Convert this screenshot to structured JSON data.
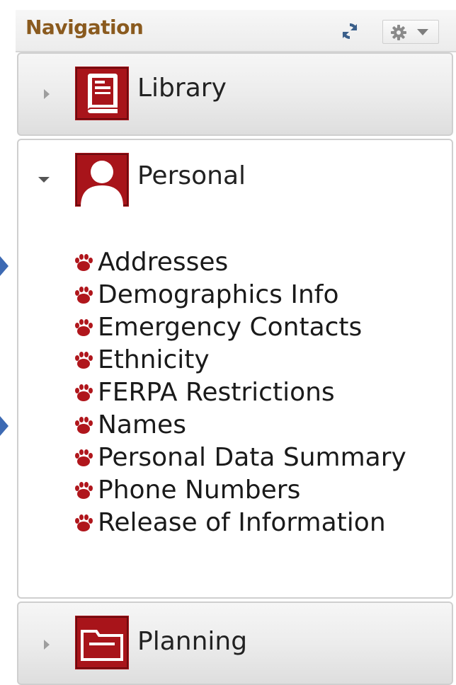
{
  "navigation": {
    "title": "Navigation",
    "refresh_icon": "refresh-icon",
    "settings_icon": "gear-icon"
  },
  "sections": [
    {
      "label": "Library",
      "state": "collapsed",
      "icon": "book-icon"
    },
    {
      "label": "Personal",
      "state": "expanded",
      "icon": "person-icon",
      "items": [
        "Addresses",
        "Demographics Info",
        "Emergency Contacts",
        "Ethnicity",
        "FERPA Restrictions",
        "Names",
        "Personal Data Summary",
        "Phone Numbers",
        "Release of Information"
      ]
    },
    {
      "label": "Planning",
      "state": "collapsed",
      "icon": "folder-icon"
    }
  ],
  "colors": {
    "accent_red": "#b0161c",
    "header_text": "#8a5a1e",
    "pointer": "#3d6ab3"
  }
}
